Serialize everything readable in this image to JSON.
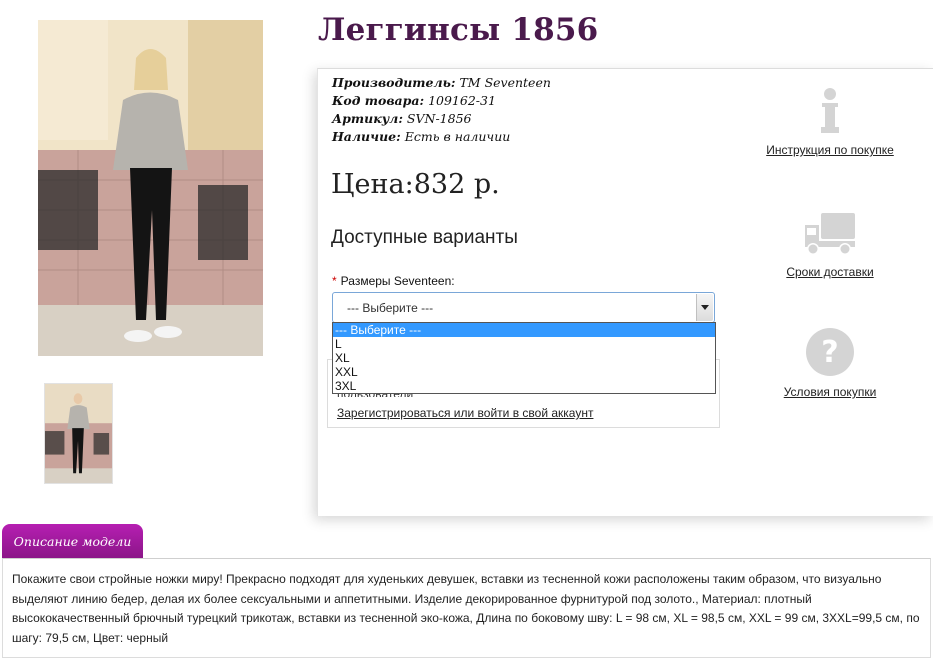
{
  "product": {
    "title": "Леггинсы 1856",
    "images": {
      "main_alt": "product-photo",
      "thumb_alt": "product-thumbnail"
    },
    "meta": [
      {
        "label": "Производитель:",
        "value": "TM Seventeen"
      },
      {
        "label": "Код товара:",
        "value": "109162-31"
      },
      {
        "label": "Артикул:",
        "value": "SVN-1856"
      },
      {
        "label": "Наличие:",
        "value": "Есть в наличии"
      }
    ],
    "price": "Цена:832 р."
  },
  "variants": {
    "title": "Доступные варианты",
    "required_mark": "*",
    "size_label": "Размеры Seventeen:",
    "selected": "--- Выберите ---",
    "options": [
      "--- Выберите ---",
      "L",
      "XL",
      "XXL",
      "3XL"
    ]
  },
  "login": {
    "hint": "пользователи",
    "link": "Зарегистрироваться или войти в свой аккаунт"
  },
  "sidebar": [
    {
      "icon": "info-icon",
      "label": "Инструкция по покупке"
    },
    {
      "icon": "truck-icon",
      "label": "Сроки доставки"
    },
    {
      "icon": "question-icon",
      "label": "Условия покупки"
    }
  ],
  "description": {
    "tab_label": "Описание модели",
    "text": "Покажите свои стройные ножки миру! Прекрасно подходят для худеньких девушек, вставки из тесненной кожи расположены таким образом, что визуально выделяют линию бедер, делая их более сексуальными и аппетитными. Изделие декорированное фурнитурой под золото., Материал: плотный высококачественный брючный турецкий трикотаж, вставки из тесненной эко-кожа, Длина по боковому шву: L = 98 см, XL = 98,5 см, XXL = 99 см, 3XXL=99,5 см, по шагу: 79,5 см, Цвет: черный"
  },
  "colors": {
    "title": "#4a1a4c",
    "tab": "#a01a9d",
    "select_border": "#7aa7d8",
    "option_selected": "#3399ff",
    "icon_gray": "#d4d4d4"
  }
}
